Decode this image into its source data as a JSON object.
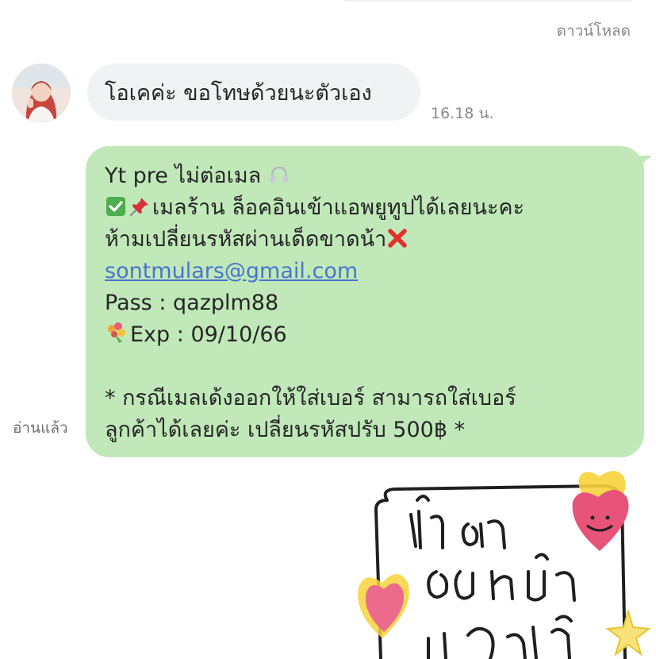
{
  "top": {
    "download_label": "ดาวน์โหลด"
  },
  "incoming": {
    "text": "โอเคค่ะ ขอโทษด้วยนะตัวเอง",
    "time": "16.18 น."
  },
  "outgoing": {
    "line1": "Yt pre ไม่ต่อเมล",
    "line2": "เมลร้าน ล็อคอินเข้าแอพยูทูปได้เลยนะคะ",
    "line3": "ห้ามเปลี่ยนรหัสผ่านเด็ดขาดน้า",
    "email": "sontmulars@gmail.com",
    "pass_line": "Pass : qazplm88",
    "exp_line": "Exp : 09/10/66",
    "note_line1": "* กรณีเมลเด้งออกให้ใส่เบอร์ สามารถใส่เบอร์",
    "note_line2": "ลูกค้าได้เลยค่ะ เปลี่ยนรหัสปรับ 500฿ *",
    "read_label": "อ่านแล้ว"
  },
  "sticker": {
    "handwritten_text": "ไว้มา อดหนุน กันอีกน้า"
  },
  "colors": {
    "outgoing_bubble": "#c0e8b8",
    "incoming_bubble": "#f1f2f4",
    "link": "#4a74d0"
  },
  "icons": [
    "headphones-icon",
    "check-mark-icon",
    "pushpin-icon",
    "cross-mark-icon",
    "bouquet-icon"
  ]
}
